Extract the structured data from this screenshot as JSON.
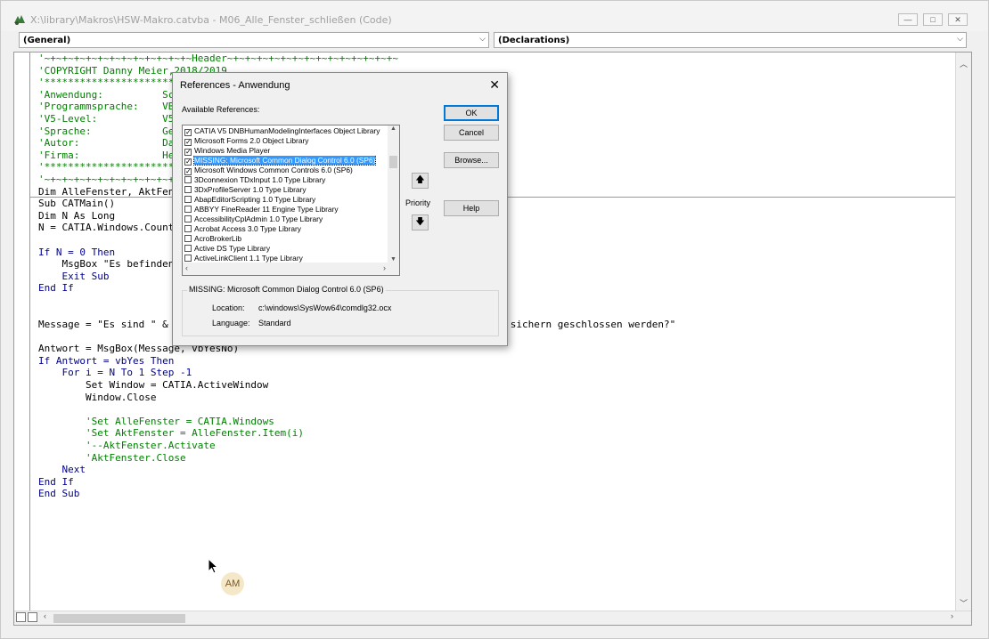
{
  "window": {
    "title": "X:\\library\\Makros\\HSW-Makro.catvba - M06_Alle_Fenster_schließen (Code)",
    "buttons": {
      "minimize": "—",
      "maximize": "□",
      "close": "✕"
    }
  },
  "combos": {
    "object": "(General)",
    "procedure": "(Declarations)"
  },
  "code_lines": [
    {
      "text": "'~+~+~+~+~+~+~+~+~+~+~+~+~Header~+~+~+~+~+~+~+~+~+~+~+~+~+~+~",
      "cls": "cm"
    },
    {
      "text": "'COPYRIGHT Danny Meier,2018/2019",
      "cls": "cm"
    },
    {
      "text": "'****************************************************************",
      "cls": "cm"
    },
    {
      "text": "'Anwendung:          Sch",
      "cls": "cm"
    },
    {
      "text": "'Programmsprache:    VBA",
      "cls": "cm"
    },
    {
      "text": "'V5-Level:           V5R",
      "cls": "cm"
    },
    {
      "text": "'Sprache:            Ger",
      "cls": "cm"
    },
    {
      "text": "'Autor:              Dan",
      "cls": "cm"
    },
    {
      "text": "'Firma:              Her",
      "cls": "cm"
    },
    {
      "text": "'****************************************************************",
      "cls": "cm"
    },
    {
      "text": "'~+~+~+~+~+~+~+~+~+~+~+~",
      "cls": "cm"
    },
    {
      "text": "Dim AlleFenster, AktFenster",
      "cls": ""
    },
    {
      "text": "Sub CATMain()",
      "cls": ""
    },
    {
      "text": "Dim N As Long",
      "cls": ""
    },
    {
      "text": "N = CATIA.Windows.Count",
      "cls": ""
    },
    {
      "text": "",
      "cls": ""
    },
    {
      "text": "If N = 0 Then",
      "cls": "kw"
    },
    {
      "text": "    MsgBox \"Es befinden",
      "cls": ""
    },
    {
      "text": "    Exit Sub",
      "cls": "kw"
    },
    {
      "text": "End If",
      "cls": "kw"
    },
    {
      "text": "",
      "cls": ""
    },
    {
      "text": "",
      "cls": ""
    },
    {
      "text": "Message = \"Es sind \" & N & \" Fenster geöffnet.\" & vbCrLf & \"Sollen alle ohne zu sichern geschlossen werden?\"",
      "cls": ""
    },
    {
      "text": "",
      "cls": ""
    },
    {
      "text": "Antwort = MsgBox(Message, vbYesNo)",
      "cls": ""
    },
    {
      "text": "If Antwort = vbYes Then",
      "cls": "kw"
    },
    {
      "text": "    For i = N To 1 Step -1",
      "cls": "kw"
    },
    {
      "text": "        Set Window = CATIA.ActiveWindow",
      "cls": ""
    },
    {
      "text": "        Window.Close",
      "cls": ""
    },
    {
      "text": "",
      "cls": ""
    },
    {
      "text": "        'Set AlleFenster = CATIA.Windows",
      "cls": "cm"
    },
    {
      "text": "        'Set AktFenster = AlleFenster.Item(i)",
      "cls": "cm"
    },
    {
      "text": "        '--AktFenster.Activate",
      "cls": "cm"
    },
    {
      "text": "        'AktFenster.Close",
      "cls": "cm"
    },
    {
      "text": "    Next",
      "cls": "kw"
    },
    {
      "text": "End If",
      "cls": "kw"
    },
    {
      "text": "End Sub",
      "cls": "kw"
    }
  ],
  "dialog": {
    "title": "References - Anwendung",
    "close": "✕",
    "available_label": "Available References:",
    "references": [
      {
        "label": "CATIA V5 DNBHumanModelingInterfaces Object Library",
        "checked": true,
        "selected": false
      },
      {
        "label": "Microsoft Forms 2.0 Object Library",
        "checked": true,
        "selected": false
      },
      {
        "label": "Windows Media Player",
        "checked": true,
        "selected": false
      },
      {
        "label": "MISSING: Microsoft Common Dialog Control 6.0 (SP6)",
        "checked": true,
        "selected": true
      },
      {
        "label": "Microsoft Windows Common Controls 6.0 (SP6)",
        "checked": true,
        "selected": false
      },
      {
        "label": "3Dconnexion TDxInput 1.0 Type Library",
        "checked": false,
        "selected": false
      },
      {
        "label": "3DxProfileServer 1.0 Type Library",
        "checked": false,
        "selected": false
      },
      {
        "label": "AbapEditorScripting 1.0 Type Library",
        "checked": false,
        "selected": false
      },
      {
        "label": "ABBYY FineReader 11 Engine Type Library",
        "checked": false,
        "selected": false
      },
      {
        "label": "AccessibilityCplAdmin 1.0 Type Library",
        "checked": false,
        "selected": false
      },
      {
        "label": "Acrobat Access 3.0 Type Library",
        "checked": false,
        "selected": false
      },
      {
        "label": "AcroBrokerLib",
        "checked": false,
        "selected": false
      },
      {
        "label": "Active DS Type Library",
        "checked": false,
        "selected": false
      },
      {
        "label": "ActiveLinkClient 1.1 Type Library",
        "checked": false,
        "selected": false
      }
    ],
    "buttons": {
      "ok": "OK",
      "cancel": "Cancel",
      "browse": "Browse...",
      "help": "Help"
    },
    "priority_label": "Priority",
    "priority_up": "🡅",
    "priority_down": "🡇",
    "info": {
      "group_title": "MISSING: Microsoft Common Dialog Control 6.0 (SP6)",
      "location_label": "Location:",
      "location_value": "c:\\windows\\SysWow64\\comdlg32.ocx",
      "language_label": "Language:",
      "language_value": "Standard"
    }
  },
  "overlay": {
    "avatar_initials": "AM"
  }
}
